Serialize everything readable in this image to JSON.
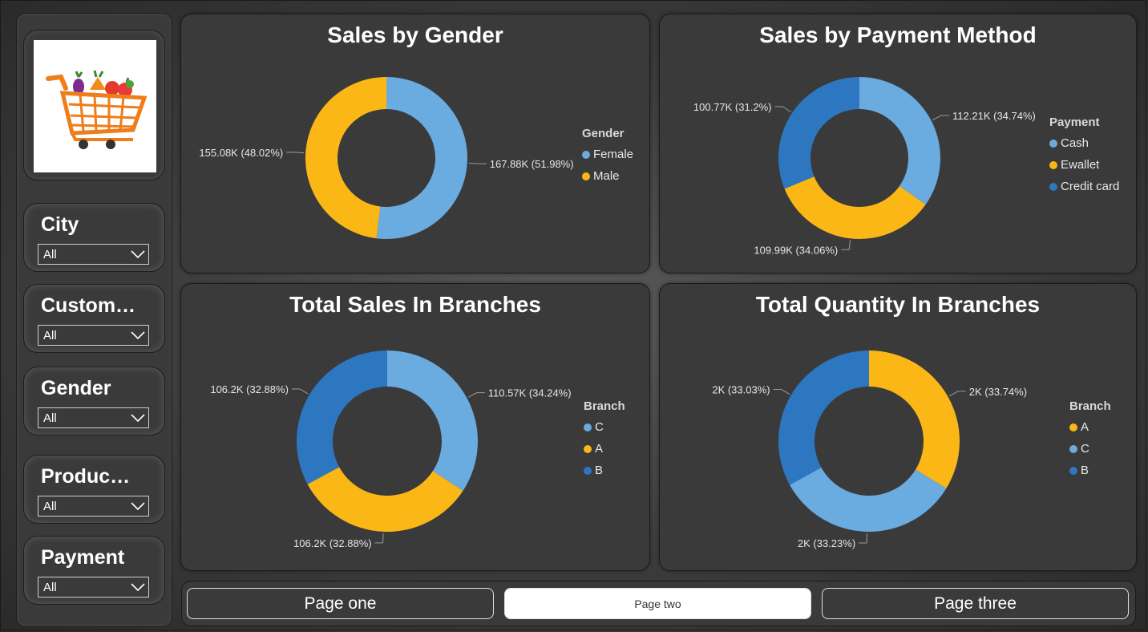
{
  "sidebar": {
    "slicers": [
      {
        "title": "City",
        "value": "All"
      },
      {
        "title": "Custom…",
        "value": "All"
      },
      {
        "title": "Gender",
        "value": "All"
      },
      {
        "title": "Produc…",
        "value": "All"
      },
      {
        "title": "Payment",
        "value": "All"
      }
    ]
  },
  "colors": {
    "light_blue": "#6aabe0",
    "yellow": "#fbb715",
    "dark_blue": "#2c77c0"
  },
  "charts": {
    "gender": {
      "title": "Sales by Gender",
      "legend_title": "Gender",
      "legend": [
        "Female",
        "Male"
      ],
      "slices": [
        {
          "name": "Female",
          "value": 167.88,
          "label": "167.88K (51.98%)",
          "color": "#6aabe0"
        },
        {
          "name": "Male",
          "value": 155.08,
          "label": "155.08K (48.02%)",
          "color": "#fbb715"
        }
      ]
    },
    "payment": {
      "title": "Sales by Payment Method",
      "legend_title": "Payment",
      "legend": [
        "Cash",
        "Ewallet",
        "Credit card"
      ],
      "slices": [
        {
          "name": "Cash",
          "value": 112.21,
          "label": "112.21K (34.74%)",
          "color": "#6aabe0"
        },
        {
          "name": "Ewallet",
          "value": 109.99,
          "label": "109.99K (34.06%)",
          "color": "#fbb715"
        },
        {
          "name": "Credit card",
          "value": 100.77,
          "label": "100.77K (31.2%)",
          "color": "#2c77c0"
        }
      ]
    },
    "sales_branches": {
      "title": "Total Sales In Branches",
      "legend_title": "Branch",
      "legend": [
        "C",
        "A",
        "B"
      ],
      "slices": [
        {
          "name": "C",
          "value": 110.57,
          "label": "110.57K (34.24%)",
          "color": "#6aabe0"
        },
        {
          "name": "A",
          "value": 106.2,
          "label": "106.2K (32.88%)",
          "color": "#fbb715"
        },
        {
          "name": "B",
          "value": 106.2,
          "label": "106.2K (32.88%)",
          "color": "#2c77c0"
        }
      ]
    },
    "quantity_branches": {
      "title": "Total Quantity In Branches",
      "legend_title": "Branch",
      "legend": [
        "A",
        "C",
        "B"
      ],
      "slices": [
        {
          "name": "A",
          "value": 33.74,
          "label": "2K (33.74%)",
          "color": "#fbb715"
        },
        {
          "name": "C",
          "value": 33.23,
          "label": "2K (33.23%)",
          "color": "#6aabe0"
        },
        {
          "name": "B",
          "value": 33.03,
          "label": "2K (33.03%)",
          "color": "#2c77c0"
        }
      ]
    }
  },
  "chart_data": [
    {
      "type": "pie",
      "title": "Sales by Gender",
      "categories": [
        "Female",
        "Male"
      ],
      "values": [
        167.88,
        155.08
      ],
      "labels": [
        "167.88K (51.98%)",
        "155.08K (48.02%)"
      ],
      "legend": "right"
    },
    {
      "type": "pie",
      "title": "Sales by Payment Method",
      "categories": [
        "Cash",
        "Ewallet",
        "Credit card"
      ],
      "values": [
        112.21,
        109.99,
        100.77
      ],
      "labels": [
        "112.21K (34.74%)",
        "109.99K (34.06%)",
        "100.77K (31.2%)"
      ],
      "legend": "right"
    },
    {
      "type": "pie",
      "title": "Total Sales In Branches",
      "categories": [
        "C",
        "A",
        "B"
      ],
      "values": [
        110.57,
        106.2,
        106.2
      ],
      "labels": [
        "110.57K (34.24%)",
        "106.2K (32.88%)",
        "106.2K (32.88%)"
      ],
      "legend": "right"
    },
    {
      "type": "pie",
      "title": "Total Quantity In Branches",
      "categories": [
        "A",
        "C",
        "B"
      ],
      "values": [
        33.74,
        33.23,
        33.03
      ],
      "labels": [
        "2K (33.74%)",
        "2K (33.23%)",
        "2K (33.03%)"
      ],
      "legend": "right"
    }
  ],
  "nav": {
    "page_one": "Page one",
    "page_two": "Page two",
    "page_three": "Page three"
  }
}
